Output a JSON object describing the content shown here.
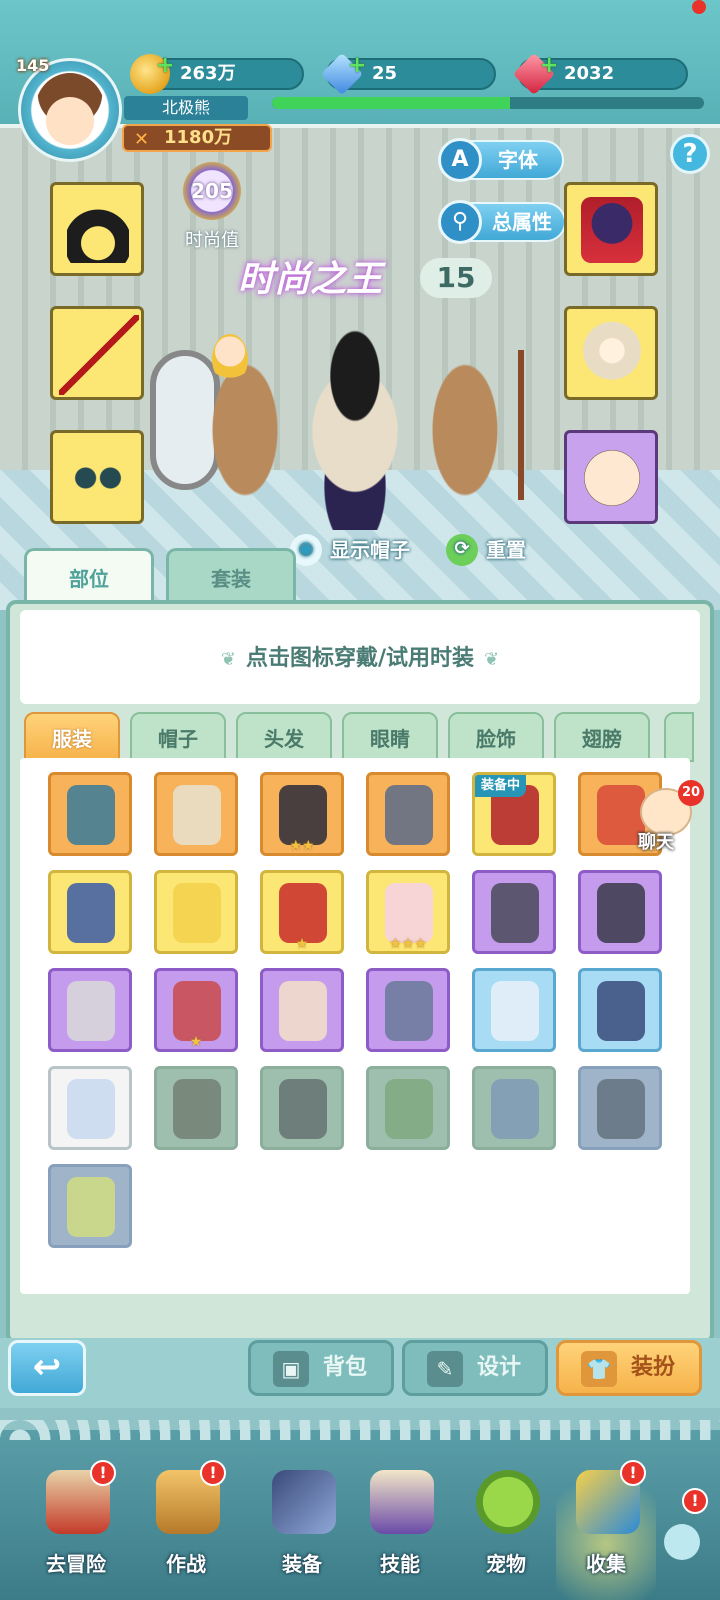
{
  "header": {
    "level": "145",
    "player_name": "北极熊",
    "power": "1180万",
    "currencies": [
      {
        "name": "coin-icon",
        "value": "263万"
      },
      {
        "name": "diamond-icon",
        "value": "25"
      },
      {
        "name": "ruby-icon",
        "value": "2032"
      }
    ],
    "exp_fraction": 0.55,
    "help": "?"
  },
  "stage": {
    "font_button": "字体",
    "font_button_icon": "A",
    "attributes_button": "总属性",
    "fashion_value": "205",
    "fashion_label": "时尚值",
    "title_text": "时尚之王",
    "title_level": "15",
    "show_hat": "显示帽子",
    "reset": "重置"
  },
  "main_tabs": [
    "部位",
    "套装"
  ],
  "hint": "点击图标穿戴/试用时装",
  "category_tabs": [
    "服装",
    "帽子",
    "头发",
    "眼睛",
    "脸饰",
    "翅膀"
  ],
  "equipped_label": "装备中",
  "items": [
    {
      "rarity": "orange",
      "stars": "",
      "equipped": false
    },
    {
      "rarity": "orange",
      "stars": "",
      "equipped": false
    },
    {
      "rarity": "orange",
      "stars": "★★",
      "equipped": false
    },
    {
      "rarity": "orange",
      "stars": "",
      "equipped": false
    },
    {
      "rarity": "yellow",
      "stars": "",
      "equipped": true
    },
    {
      "rarity": "orange",
      "stars": "",
      "equipped": false
    },
    {
      "rarity": "yellow",
      "stars": "",
      "equipped": false
    },
    {
      "rarity": "yellow",
      "stars": "",
      "equipped": false
    },
    {
      "rarity": "yellow",
      "stars": "★",
      "equipped": false
    },
    {
      "rarity": "yellow",
      "stars": "★★★",
      "equipped": false
    },
    {
      "rarity": "purple",
      "stars": "",
      "equipped": false
    },
    {
      "rarity": "purple",
      "stars": "",
      "equipped": false
    },
    {
      "rarity": "purple",
      "stars": "",
      "equipped": false
    },
    {
      "rarity": "purple",
      "stars": "★",
      "equipped": false
    },
    {
      "rarity": "purple",
      "stars": "",
      "equipped": false
    },
    {
      "rarity": "purple",
      "stars": "",
      "equipped": false
    },
    {
      "rarity": "blue",
      "stars": "",
      "equipped": false
    },
    {
      "rarity": "blue",
      "stars": "",
      "equipped": false
    },
    {
      "rarity": "white",
      "stars": "",
      "equipped": false
    },
    {
      "rarity": "locked",
      "stars": "",
      "equipped": false
    },
    {
      "rarity": "locked",
      "stars": "",
      "equipped": false
    },
    {
      "rarity": "locked",
      "stars": "",
      "equipped": false
    },
    {
      "rarity": "locked",
      "stars": "",
      "equipped": false
    },
    {
      "rarity": "locked-blue",
      "stars": "",
      "equipped": false
    },
    {
      "rarity": "locked-blue",
      "stars": "",
      "equipped": false
    }
  ],
  "chat": {
    "badge": "20",
    "label": "聊天"
  },
  "toolbar": {
    "back_icon": "↩",
    "bag": "背包",
    "design": "设计",
    "dress_up": "装扮"
  },
  "nav": [
    {
      "label": "去冒险",
      "alert": "!"
    },
    {
      "label": "作战",
      "alert": "!"
    },
    {
      "label": "装备",
      "alert": ""
    },
    {
      "label": "技能",
      "alert": ""
    },
    {
      "label": "宠物",
      "alert": ""
    },
    {
      "label": "收集",
      "alert": "!"
    }
  ],
  "nav_extra_alert": "!",
  "colors": {
    "accent_teal": "#4fa29a",
    "active_tab": "#f6b24a",
    "alert_red": "#e8322a"
  }
}
